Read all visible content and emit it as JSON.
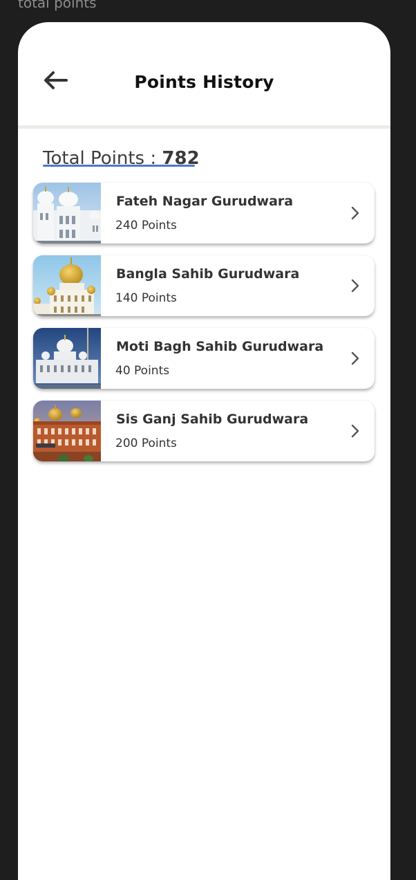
{
  "frame_label": "total points",
  "header": {
    "back_icon": "arrow-left-icon",
    "title": "Points History"
  },
  "summary": {
    "label": "Total Points : ",
    "value": "782",
    "underline_color": "#4d79c6"
  },
  "places": [
    {
      "name": "Fateh Nagar Gurudwara",
      "points": "240 Points",
      "chevron_icon": "chevron-right-icon"
    },
    {
      "name": "Bangla Sahib Gurudwara",
      "points": "140 Points",
      "chevron_icon": "chevron-right-icon"
    },
    {
      "name": "Moti Bagh Sahib Gurudwara",
      "points": "40 Points",
      "chevron_icon": "chevron-right-icon"
    },
    {
      "name": "Sis Ganj Sahib Gurudwara",
      "points": "200 Points",
      "chevron_icon": "chevron-right-icon"
    }
  ],
  "colors": {
    "background": "#1e1e1e",
    "card": "#ffffff",
    "text": "#333333",
    "divider": "#ecece8"
  }
}
